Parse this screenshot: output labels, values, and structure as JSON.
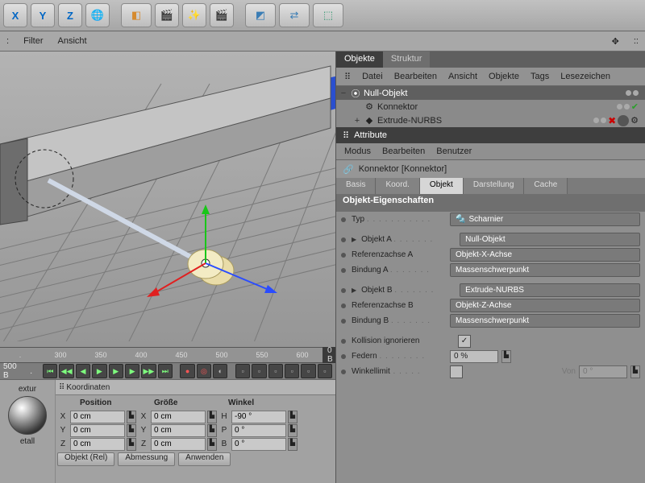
{
  "toolbar": {
    "axes": [
      "X",
      "Y",
      "Z"
    ]
  },
  "subbar": {
    "a": ":",
    "b": "Filter",
    "c": "Ansicht",
    "d": "::"
  },
  "ruler": {
    "ticks": [
      ".",
      "300",
      "350",
      "400",
      "450",
      "500",
      "550",
      "600"
    ],
    "frame": "0 B",
    "left_label": "500 B",
    "left_mark": "."
  },
  "coords": {
    "title": "Koordinaten",
    "mat_labels": [
      "extur",
      "etall"
    ],
    "headers": [
      "Position",
      "Größe",
      "Winkel"
    ],
    "rows": [
      {
        "a": "X",
        "v1": "0 cm",
        "v2": "0 cm",
        "a2": "H",
        "v3": "-90 °"
      },
      {
        "a": "Y",
        "v1": "0 cm",
        "v2": "0 cm",
        "a2": "P",
        "v3": "0 °"
      },
      {
        "a": "Z",
        "v1": "0 cm",
        "v2": "0 cm",
        "a2": "B",
        "v3": "0 °"
      }
    ],
    "buttons": [
      "Objekt (Rel)",
      "Abmessung",
      "Anwenden"
    ]
  },
  "panel": {
    "tabs": [
      "Objekte",
      "Struktur"
    ],
    "menu": [
      "Datei",
      "Bearbeiten",
      "Ansicht",
      "Objekte",
      "Tags",
      "Lesezeichen"
    ]
  },
  "tree": {
    "items": [
      {
        "name": "Null-Objekt",
        "icon": "⦿",
        "indent": 0,
        "sel": true,
        "exp": "−"
      },
      {
        "name": "Konnektor",
        "icon": "⚙",
        "indent": 1,
        "sel": false,
        "exp": ""
      },
      {
        "name": "Extrude-NURBS",
        "icon": "◆",
        "indent": 1,
        "sel": false,
        "exp": "+"
      }
    ]
  },
  "attr": {
    "title": "Attribute",
    "menu": [
      "Modus",
      "Bearbeiten",
      "Benutzer"
    ],
    "obj": "Konnektor [Konnektor]",
    "tabs": [
      "Basis",
      "Koord.",
      "Objekt",
      "Darstellung",
      "Cache"
    ],
    "section": "Objekt-Eigenschaften",
    "props": {
      "typ_l": "Typ",
      "typ_v": "Scharnier",
      "oa_l": "Objekt A",
      "oa_v": "Null-Objekt",
      "ra_l": "Referenzachse A",
      "ra_v": "Objekt-X-Achse",
      "ba_l": "Bindung A",
      "ba_v": "Massenschwerpunkt",
      "ob_l": "Objekt B",
      "ob_v": "Extrude-NURBS",
      "rb_l": "Referenzachse B",
      "rb_v": "Objekt-Z-Achse",
      "bb_l": "Bindung B",
      "bb_v": "Massenschwerpunkt",
      "koll_l": "Kollision ignorieren",
      "fed_l": "Federn",
      "fed_v": "0 %",
      "wl_l": "Winkellimit",
      "wl_von": "Von",
      "wl_von_v": "0 °"
    }
  }
}
